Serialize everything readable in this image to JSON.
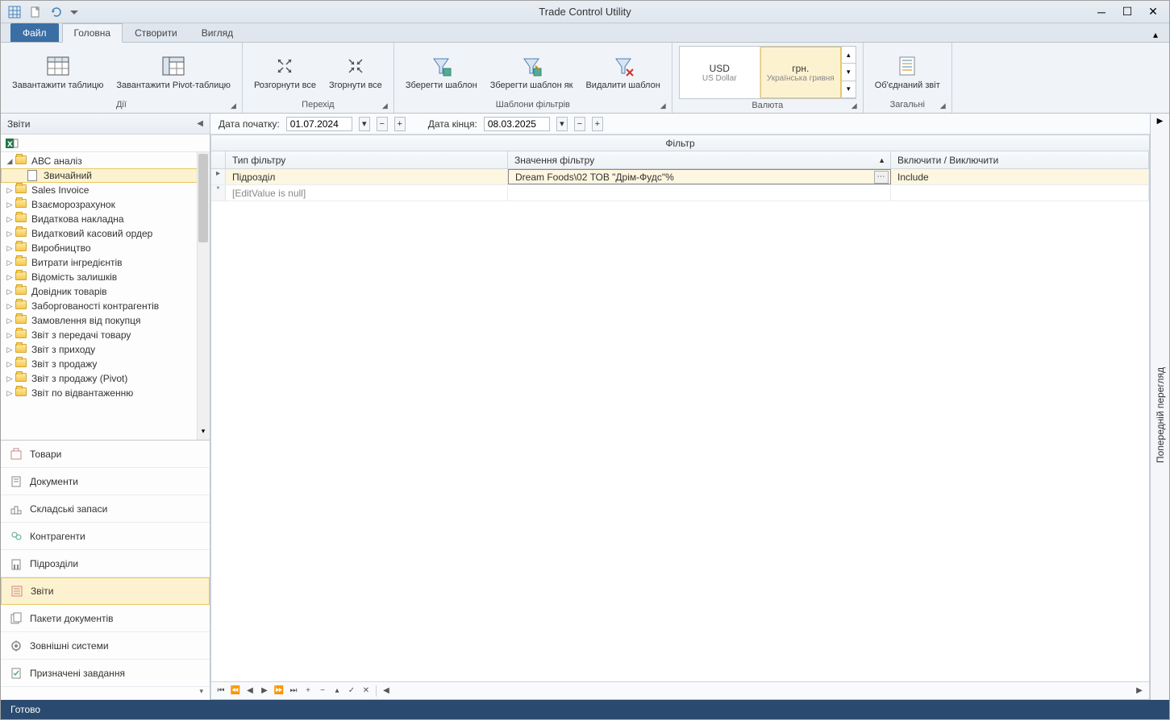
{
  "window": {
    "title": "Trade Control Utility"
  },
  "tabs": {
    "file": "Файл",
    "items": [
      "Головна",
      "Створити",
      "Вигляд"
    ],
    "active": 0
  },
  "ribbon": {
    "groups": {
      "actions": {
        "label": "Дії",
        "load_table": "Завантажити таблицю",
        "load_pivot": "Завантажити Pivot-таблицю"
      },
      "transition": {
        "label": "Перехід",
        "expand_all": "Розгорнути все",
        "collapse_all": "Згорнути все"
      },
      "filter_templates": {
        "label": "Шаблони фільтрів",
        "save_template": "Зберегти шаблон",
        "save_template_as": "Зберегти шаблон як",
        "delete_template": "Видалити шаблон"
      },
      "currency": {
        "label": "Валюта",
        "items": [
          {
            "sym": "USD",
            "name": "US Dollar",
            "selected": false
          },
          {
            "sym": "грн.",
            "name": "Українська гривня",
            "selected": true
          }
        ]
      },
      "general": {
        "label": "Загальні",
        "combined_report": "Об'єднаний звіт"
      }
    }
  },
  "sidebar": {
    "title": "Звіти",
    "tree": {
      "root": {
        "label": "АВС аналіз",
        "expanded": true
      },
      "root_child": {
        "label": "Звичайний",
        "selected": true
      },
      "folders": [
        "Sales Invoice",
        "Взаєморозрахунок",
        "Видаткова накладна",
        "Видатковий касовий ордер",
        "Виробництво",
        "Витрати інгредієнтів",
        "Відомість залишків",
        "Довідник товарів",
        "Заборгованості контрагентів",
        "Замовлення від покупця",
        "Звіт з передачі товару",
        "Звіт з приходу",
        "Звіт з продажу",
        "Звіт з продажу (Pivot)",
        "Звіт по відвантаженню"
      ]
    },
    "nav": [
      "Товари",
      "Документи",
      "Складські запаси",
      "Контрагенти",
      "Підрозділи",
      "Звіти",
      "Пакети документів",
      "Зовнішні системи",
      "Призначені завдання"
    ],
    "nav_active": 5
  },
  "datebar": {
    "start_label": "Дата початку:",
    "start_value": "01.07.2024",
    "end_label": "Дата кінця:",
    "end_value": "08.03.2025"
  },
  "grid": {
    "title": "Фільтр",
    "headers": {
      "type": "Тип фільтру",
      "value": "Значення фільтру",
      "include": "Включити / Виключити"
    },
    "row1": {
      "type": "Підрозділ",
      "value": "Dream Foods\\02 ТОВ \"Дрім-Фудс\"%",
      "include": "Include"
    },
    "newrow": {
      "placeholder": "[EditValue is null]"
    }
  },
  "right_rail": {
    "label": "Попередній перегляд"
  },
  "statusbar": {
    "text": "Готово"
  }
}
